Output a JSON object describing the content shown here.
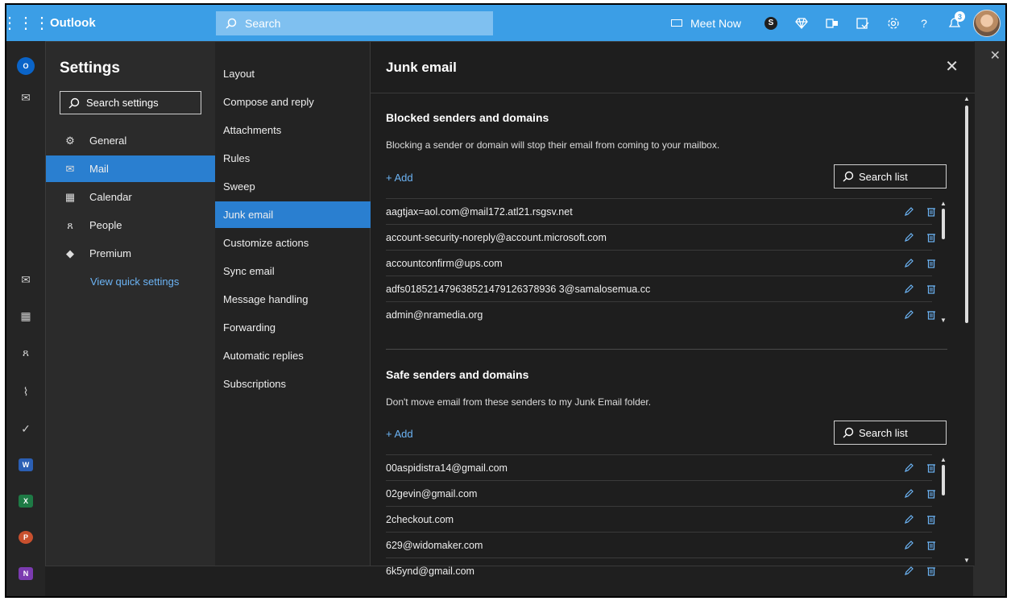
{
  "topbar": {
    "app_name": "Outlook",
    "search_placeholder": "Search",
    "meet_now": "Meet Now",
    "notification_count": "3"
  },
  "settings": {
    "title": "Settings",
    "search_placeholder": "Search settings",
    "categories": [
      {
        "label": "General",
        "icon": "gear-icon"
      },
      {
        "label": "Mail",
        "icon": "mail-icon",
        "active": true
      },
      {
        "label": "Calendar",
        "icon": "calendar-icon"
      },
      {
        "label": "People",
        "icon": "people-icon"
      },
      {
        "label": "Premium",
        "icon": "diamond-icon"
      }
    ],
    "quick_settings": "View quick settings",
    "mail_sections": [
      "Layout",
      "Compose and reply",
      "Attachments",
      "Rules",
      "Sweep",
      "Junk email",
      "Customize actions",
      "Sync email",
      "Message handling",
      "Forwarding",
      "Automatic replies",
      "Subscriptions"
    ],
    "active_section": "Junk email"
  },
  "junk": {
    "title": "Junk email",
    "blocked": {
      "title": "Blocked senders and domains",
      "description": "Blocking a sender or domain will stop their email from coming to your mailbox.",
      "add_label": "Add",
      "search_label": "Search list",
      "items": [
        "aagtjax=aol.com@mail172.atl21.rsgsv.net",
        "account-security-noreply@account.microsoft.com",
        "accountconfirm@ups.com",
        "adfs018521479638521479126378936 3@samalosemua.cc",
        "admin@nramedia.org"
      ]
    },
    "safe": {
      "title": "Safe senders and domains",
      "description": "Don't move email from these senders to my Junk Email folder.",
      "add_label": "Add",
      "search_label": "Search list",
      "items": [
        "00aspidistra14@gmail.com",
        "02gevin@gmail.com",
        "2checkout.com",
        "629@widomaker.com",
        "6k5ynd@gmail.com"
      ]
    }
  },
  "colors": {
    "brand": "#3b9ee6",
    "accent_active": "#2a7fd0",
    "link": "#6cb4f5",
    "panel_bg": "#1e1e1e"
  }
}
